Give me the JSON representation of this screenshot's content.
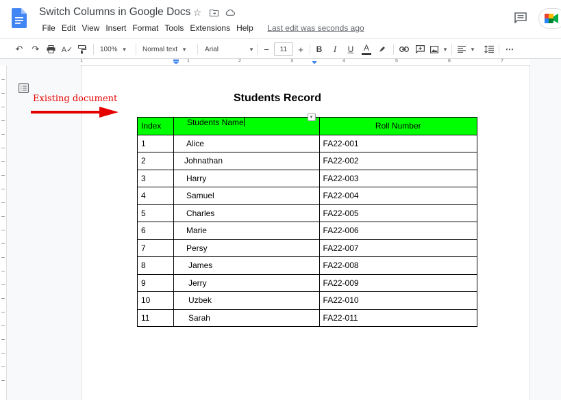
{
  "app": {
    "doc_title": "Switch Columns in Google Docs",
    "menu": [
      "File",
      "Edit",
      "View",
      "Insert",
      "Format",
      "Tools",
      "Extensions",
      "Help"
    ],
    "last_edit": "Last edit was seconds ago",
    "brand_color": "#4285f4"
  },
  "toolbar": {
    "zoom": "100%",
    "style": "Normal text",
    "font": "Arial",
    "font_size": "11"
  },
  "ruler": {
    "numbers": [
      "1",
      "1",
      "2",
      "3",
      "4",
      "5",
      "6",
      "7"
    ]
  },
  "annotation": {
    "text": "Existing document",
    "color": "#e50000"
  },
  "document": {
    "heading": "Students Record",
    "table": {
      "header_color": "#00ff00",
      "columns": [
        "Index",
        "Students Name",
        "Roll Number"
      ],
      "rows": [
        [
          "1",
          "Alice",
          "FA22-001"
        ],
        [
          "2",
          "Johnathan",
          "FA22-002"
        ],
        [
          "3",
          "Harry",
          "FA22-003"
        ],
        [
          "4",
          "Samuel",
          "FA22-004"
        ],
        [
          "5",
          "Charles",
          "FA22-005"
        ],
        [
          "6",
          "Marie",
          "FA22-006"
        ],
        [
          "7",
          "Persy",
          "FA22-007"
        ],
        [
          "8",
          "James",
          "FA22-008"
        ],
        [
          "9",
          "Jerry",
          "FA22-009"
        ],
        [
          "10",
          "Uzbek",
          "FA22-010"
        ],
        [
          "11",
          "Sarah",
          "FA22-011"
        ]
      ]
    }
  }
}
